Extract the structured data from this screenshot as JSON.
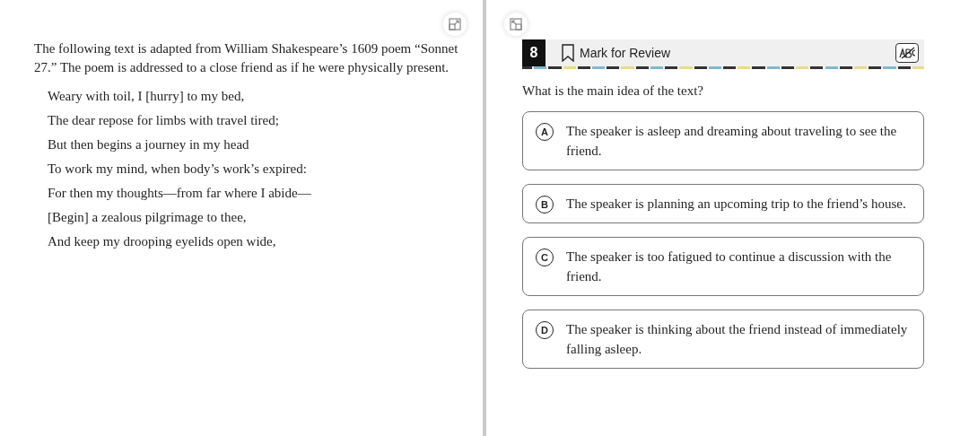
{
  "passage": {
    "intro": "The following text is adapted from William Shakespeare’s 1609 poem “Sonnet 27.” The poem is addressed to a close friend as if he were physically present.",
    "lines": [
      "Weary with toil, I [hurry] to my bed,",
      "The dear repose for limbs with travel tired;",
      "But then begins a journey in my head",
      "To work my mind, when body’s work’s expired:",
      "For then my thoughts—from far where I abide—",
      "[Begin] a zealous pilgrimage to thee,",
      "And keep my drooping eyelids open wide,"
    ]
  },
  "question": {
    "number": "8",
    "mark_for_review": {
      "label": "Mark for Review",
      "checked": false
    },
    "prompt": "What is the main idea of the text?",
    "options": [
      {
        "letter": "A",
        "text": "The speaker is asleep and dreaming about traveling to see the friend.",
        "selected": false
      },
      {
        "letter": "B",
        "text": "The speaker is planning an upcoming trip to the friend’s house.",
        "selected": false
      },
      {
        "letter": "C",
        "text": "The speaker is too fatigued to continue a discussion with the friend.",
        "selected": false
      },
      {
        "letter": "D",
        "text": "The speaker is thinking about the friend instead of immediately falling asleep.",
        "selected": false
      }
    ]
  }
}
